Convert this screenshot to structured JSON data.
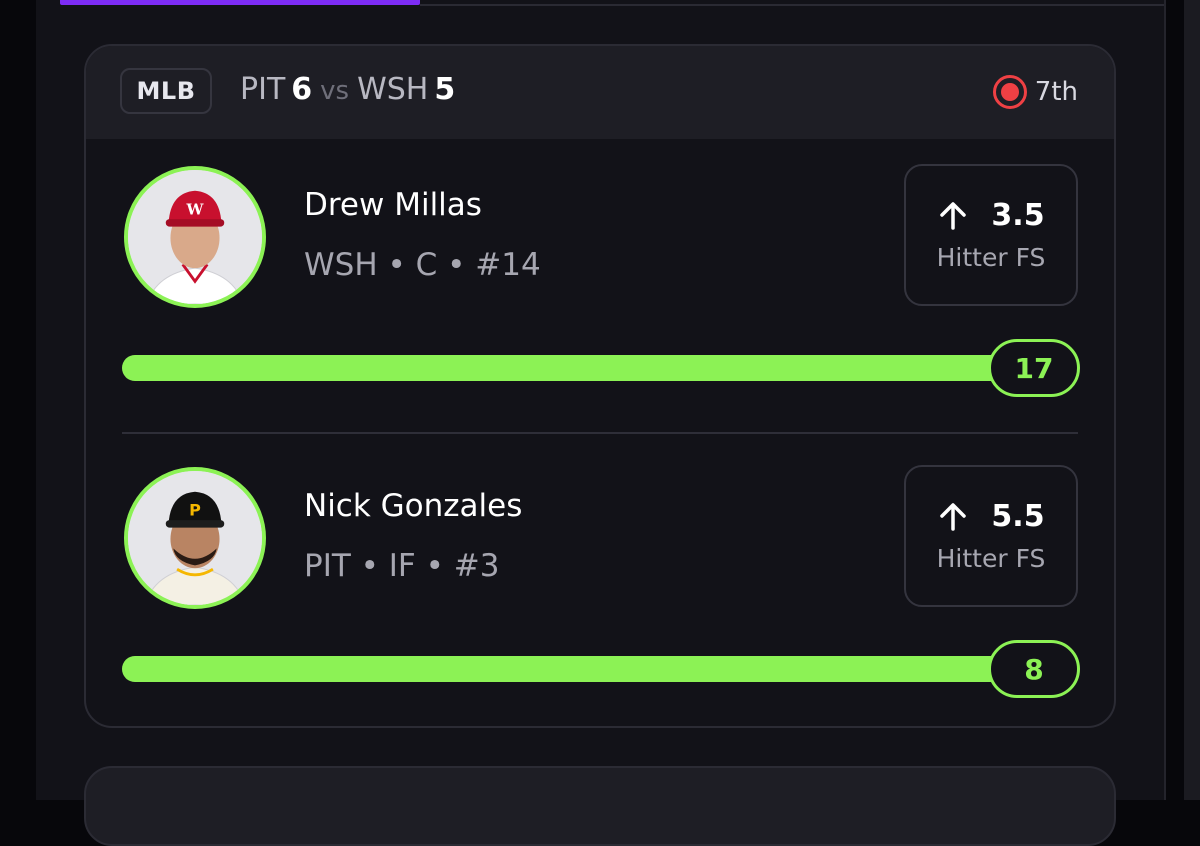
{
  "game": {
    "league": "MLB",
    "away_team": "PIT",
    "away_score": "6",
    "vs": "vs",
    "home_team": "WSH",
    "home_score": "5",
    "inning": "7th"
  },
  "players": [
    {
      "name": "Drew Millas",
      "meta": "WSH • C • #14",
      "line": "3.5",
      "stat_label": "Hitter FS",
      "direction_icon": "arrow-up-icon",
      "progress_value": "17",
      "progress_fraction": 1.0,
      "cap_color": "#c8102e"
    },
    {
      "name": "Nick Gonzales",
      "meta": "PIT • IF • #3",
      "line": "5.5",
      "stat_label": "Hitter FS",
      "direction_icon": "arrow-up-icon",
      "progress_value": "8",
      "progress_fraction": 1.0,
      "cap_color": "#111111"
    }
  ],
  "colors": {
    "accent_green": "#8cf255",
    "tab_accent": "#7d2cf5",
    "live_red": "#ef4044",
    "background": "#121218"
  }
}
